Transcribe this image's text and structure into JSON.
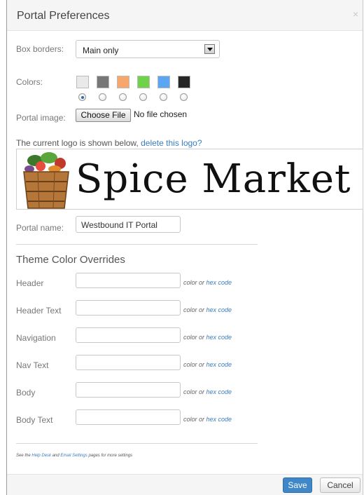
{
  "dialog": {
    "title": "Portal Preferences",
    "close_glyph": "×"
  },
  "box_borders": {
    "label": "Box borders:",
    "value": "Main only"
  },
  "colors": {
    "label": "Colors:",
    "swatches": [
      {
        "name": "light gray",
        "color": "#e9e9e9"
      },
      {
        "name": "gray",
        "color": "#777777"
      },
      {
        "name": "orange",
        "color": "#f7a66d"
      },
      {
        "name": "green",
        "color": "#6fd34a"
      },
      {
        "name": "blue",
        "color": "#5aa6f2"
      },
      {
        "name": "black",
        "color": "#262626"
      }
    ],
    "selected_index": 0
  },
  "portal_image": {
    "label": "Portal image:",
    "button": "Choose File",
    "status": "No file chosen"
  },
  "logo": {
    "caption": "The current logo is shown below,",
    "delete_link": "delete this logo?",
    "image_text": "Spice Market"
  },
  "portal_name": {
    "label": "Portal name:",
    "value": "Westbound IT Portal"
  },
  "overrides": {
    "title": "Theme Color Overrides",
    "hint_prefix": "color or",
    "hint_link": "hex code",
    "fields": [
      {
        "label": "Header",
        "value": ""
      },
      {
        "label": "Header Text",
        "value": ""
      },
      {
        "label": "Navigation",
        "value": ""
      },
      {
        "label": "Nav Text",
        "value": ""
      },
      {
        "label": "Body",
        "value": ""
      },
      {
        "label": "Body Text",
        "value": ""
      }
    ]
  },
  "footnote": {
    "prefix": "See the",
    "link1": "Help Desk",
    "middle": "and",
    "link2": "Email Settings",
    "suffix": "pages for more settings"
  },
  "buttons": {
    "save": "Save",
    "cancel": "Cancel"
  }
}
